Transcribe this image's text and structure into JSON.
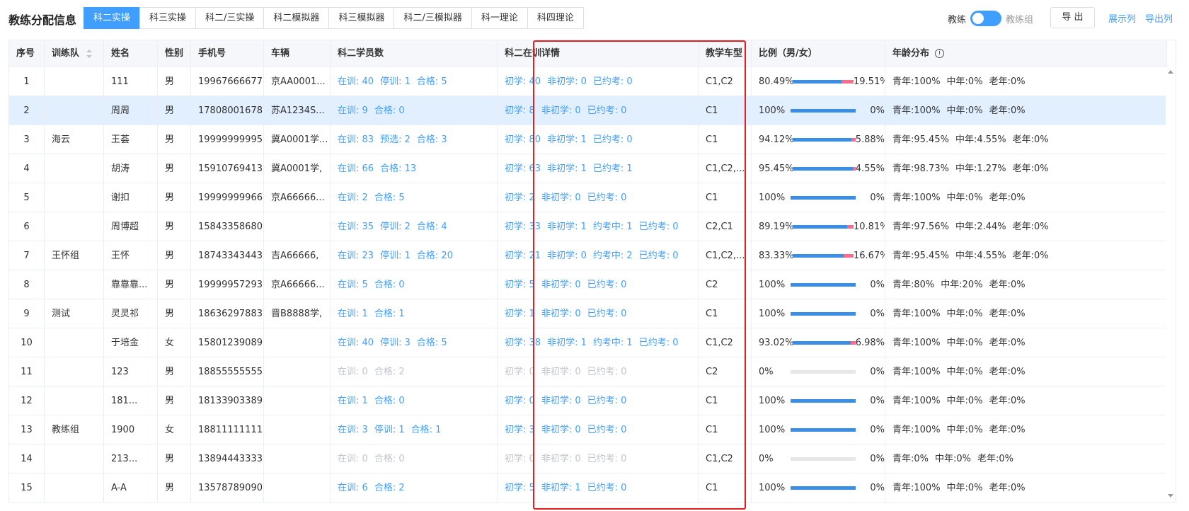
{
  "header": {
    "title": "教练分配信息",
    "tabs": [
      {
        "label": "科二实操",
        "active": true
      },
      {
        "label": "科三实操",
        "active": false
      },
      {
        "label": "科二/三实操",
        "active": false
      },
      {
        "label": "科二模拟器",
        "active": false
      },
      {
        "label": "科三模拟器",
        "active": false
      },
      {
        "label": "科二/三模拟器",
        "active": false
      },
      {
        "label": "科一理论",
        "active": false
      },
      {
        "label": "科四理论",
        "active": false
      }
    ],
    "switch_left": "教练",
    "switch_right": "教练组",
    "export_label": "导 出",
    "show_columns": "展示列",
    "export_columns": "导出列"
  },
  "colors": {
    "accent": "#409eff",
    "highlight": "#e2efff",
    "male_bar": "#3a8ee6",
    "female_bar": "#f56c8d",
    "frame": "#e02020"
  },
  "columns": [
    "序号",
    "训练队",
    "姓名",
    "性别",
    "手机号",
    "车辆",
    "科二学员数",
    "科二在训详情",
    "教学车型",
    "比例（男/女）",
    "年龄分布"
  ],
  "rows": [
    {
      "no": "1",
      "team": "",
      "name": "111",
      "gender": "男",
      "phone": "19967666677",
      "car": "京AA0001...",
      "students": [
        [
          "在训",
          "40"
        ],
        [
          "停训",
          "1"
        ],
        [
          "合格",
          "5"
        ]
      ],
      "detail": [
        [
          "初学",
          "40"
        ],
        [
          "非初学",
          "0"
        ],
        [
          "已约考",
          "0"
        ]
      ],
      "cartype": "C1,C2",
      "male": "80.49%",
      "female": "19.51%",
      "male_ratio": 0.8049,
      "age": [
        "青年:100%",
        "中年:0%",
        "老年:0%"
      ],
      "muted": false
    },
    {
      "no": "2",
      "team": "",
      "name": "周周",
      "gender": "男",
      "phone": "17808001678",
      "car": "苏A1234S...",
      "students": [
        [
          "在训",
          "9"
        ],
        [
          "合格",
          "0"
        ]
      ],
      "detail": [
        [
          "初学",
          "8"
        ],
        [
          "非初学",
          "0"
        ],
        [
          "已约考",
          "0"
        ]
      ],
      "cartype": "C1",
      "male": "100%",
      "female": "0%",
      "male_ratio": 1,
      "age": [
        "青年:100%",
        "中年:0%",
        "老年:0%"
      ],
      "muted": false,
      "highlight": true
    },
    {
      "no": "3",
      "team": "海云",
      "name": "王荟",
      "gender": "男",
      "phone": "19999999995",
      "car": "冀A0001学...",
      "students": [
        [
          "在训",
          "83"
        ],
        [
          "预选",
          "2"
        ],
        [
          "合格",
          "3"
        ]
      ],
      "detail": [
        [
          "初学",
          "80"
        ],
        [
          "非初学",
          "1"
        ],
        [
          "已约考",
          "0"
        ]
      ],
      "cartype": "C1",
      "male": "94.12%",
      "female": "5.88%",
      "male_ratio": 0.9412,
      "age": [
        "青年:95.45%",
        "中年:4.55%",
        "老年:0%"
      ],
      "muted": false
    },
    {
      "no": "4",
      "team": "",
      "name": "胡涛",
      "gender": "男",
      "phone": "15910769413",
      "car": "冀A0001学,",
      "students": [
        [
          "在训",
          "66"
        ],
        [
          "合格",
          "13"
        ]
      ],
      "detail": [
        [
          "初学",
          "63"
        ],
        [
          "非初学",
          "1"
        ],
        [
          "已约考",
          "1"
        ]
      ],
      "cartype": "C1,C2,...",
      "male": "95.45%",
      "female": "4.55%",
      "male_ratio": 0.9545,
      "age": [
        "青年:98.73%",
        "中年:1.27%",
        "老年:0%"
      ],
      "muted": false
    },
    {
      "no": "5",
      "team": "",
      "name": "谢扣",
      "gender": "男",
      "phone": "19999999966",
      "car": "京A66666...",
      "students": [
        [
          "在训",
          "2"
        ],
        [
          "合格",
          "5"
        ]
      ],
      "detail": [
        [
          "初学",
          "2"
        ],
        [
          "非初学",
          "0"
        ],
        [
          "已约考",
          "0"
        ]
      ],
      "cartype": "C1",
      "male": "100%",
      "female": "0%",
      "male_ratio": 1,
      "age": [
        "青年:100%",
        "中年:0%",
        "老年:0%"
      ],
      "muted": false
    },
    {
      "no": "6",
      "team": "",
      "name": "周博超",
      "gender": "男",
      "phone": "15843358680",
      "car": "",
      "students": [
        [
          "在训",
          "35"
        ],
        [
          "停训",
          "2"
        ],
        [
          "合格",
          "4"
        ]
      ],
      "detail": [
        [
          "初学",
          "33"
        ],
        [
          "非初学",
          "1"
        ],
        [
          "约考中",
          "1"
        ],
        [
          "已约考",
          "0"
        ]
      ],
      "cartype": "C2,C1",
      "male": "89.19%",
      "female": "10.81%",
      "male_ratio": 0.8919,
      "age": [
        "青年:97.56%",
        "中年:2.44%",
        "老年:0%"
      ],
      "muted": false
    },
    {
      "no": "7",
      "team": "王怀组",
      "name": "王怀",
      "gender": "男",
      "phone": "18743343443",
      "car": "吉A66666,",
      "students": [
        [
          "在训",
          "23"
        ],
        [
          "停训",
          "1"
        ],
        [
          "合格",
          "20"
        ]
      ],
      "detail": [
        [
          "初学",
          "21"
        ],
        [
          "非初学",
          "0"
        ],
        [
          "约考中",
          "2"
        ],
        [
          "已约考",
          "0"
        ]
      ],
      "cartype": "C1,C2,...",
      "male": "83.33%",
      "female": "16.67%",
      "male_ratio": 0.8333,
      "age": [
        "青年:95.45%",
        "中年:4.55%",
        "老年:0%"
      ],
      "muted": false
    },
    {
      "no": "8",
      "team": "",
      "name": "靠靠靠...",
      "gender": "男",
      "phone": "19999957293",
      "car": "京A66666...",
      "students": [
        [
          "在训",
          "5"
        ],
        [
          "合格",
          "0"
        ]
      ],
      "detail": [
        [
          "初学",
          "5"
        ],
        [
          "非初学",
          "0"
        ],
        [
          "已约考",
          "0"
        ]
      ],
      "cartype": "C2",
      "male": "100%",
      "female": "0%",
      "male_ratio": 1,
      "age": [
        "青年:80%",
        "中年:20%",
        "老年:0%"
      ],
      "muted": false
    },
    {
      "no": "9",
      "team": "测试",
      "name": "灵灵祁",
      "gender": "男",
      "phone": "18636297883",
      "car": "晋B8888学,",
      "students": [
        [
          "在训",
          "1"
        ],
        [
          "合格",
          "1"
        ]
      ],
      "detail": [
        [
          "初学",
          "1"
        ],
        [
          "非初学",
          "0"
        ],
        [
          "已约考",
          "0"
        ]
      ],
      "cartype": "C1",
      "male": "100%",
      "female": "0%",
      "male_ratio": 1,
      "age": [
        "青年:100%",
        "中年:0%",
        "老年:0%"
      ],
      "muted": false
    },
    {
      "no": "10",
      "team": "",
      "name": "于培金",
      "gender": "女",
      "phone": "15801239089",
      "car": "",
      "students": [
        [
          "在训",
          "40"
        ],
        [
          "停训",
          "3"
        ],
        [
          "合格",
          "5"
        ]
      ],
      "detail": [
        [
          "初学",
          "38"
        ],
        [
          "非初学",
          "1"
        ],
        [
          "约考中",
          "1"
        ],
        [
          "已约考",
          "0"
        ]
      ],
      "cartype": "C1,C2",
      "male": "93.02%",
      "female": "6.98%",
      "male_ratio": 0.9302,
      "age": [
        "青年:100%",
        "中年:0%",
        "老年:0%"
      ],
      "muted": false
    },
    {
      "no": "11",
      "team": "",
      "name": "123",
      "gender": "男",
      "phone": "18855555555",
      "car": "",
      "students": [
        [
          "在训",
          "0"
        ],
        [
          "合格",
          "2"
        ]
      ],
      "detail": [
        [
          "初学",
          "0"
        ],
        [
          "非初学",
          "0"
        ],
        [
          "已约考",
          "0"
        ]
      ],
      "cartype": "C2",
      "male": "0%",
      "female": "0%",
      "male_ratio": 0,
      "age": [
        "青年:100%",
        "中年:0%",
        "老年:0%"
      ],
      "muted": true
    },
    {
      "no": "12",
      "team": "",
      "name": "181...",
      "gender": "男",
      "phone": "18133903389",
      "car": "",
      "students": [
        [
          "在训",
          "1"
        ],
        [
          "合格",
          "0"
        ]
      ],
      "detail": [
        [
          "初学",
          "0"
        ],
        [
          "非初学",
          "0"
        ],
        [
          "已约考",
          "0"
        ]
      ],
      "cartype": "C1",
      "male": "100%",
      "female": "0%",
      "male_ratio": 1,
      "age": [
        "青年:100%",
        "中年:0%",
        "老年:0%"
      ],
      "muted": false
    },
    {
      "no": "13",
      "team": "教练组",
      "name": "1900",
      "gender": "女",
      "phone": "18811111111",
      "car": "",
      "students": [
        [
          "在训",
          "3"
        ],
        [
          "停训",
          "1"
        ],
        [
          "合格",
          "1"
        ]
      ],
      "detail": [
        [
          "初学",
          "3"
        ],
        [
          "非初学",
          "0"
        ],
        [
          "已约考",
          "0"
        ]
      ],
      "cartype": "C1",
      "male": "100%",
      "female": "0%",
      "male_ratio": 1,
      "age": [
        "青年:100%",
        "中年:0%",
        "老年:0%"
      ],
      "muted": false
    },
    {
      "no": "14",
      "team": "",
      "name": "213...",
      "gender": "男",
      "phone": "13894443333",
      "car": "",
      "students": [
        [
          "在训",
          "0"
        ],
        [
          "合格",
          "0"
        ]
      ],
      "detail": [
        [
          "初学",
          "0"
        ],
        [
          "非初学",
          "0"
        ],
        [
          "已约考",
          "0"
        ]
      ],
      "cartype": "C1,C2",
      "male": "0%",
      "female": "0%",
      "male_ratio": 0,
      "age": [
        "青年:0%",
        "中年:0%",
        "老年:0%"
      ],
      "muted": true
    },
    {
      "no": "15",
      "team": "",
      "name": "A-A",
      "gender": "男",
      "phone": "13578789090",
      "car": "",
      "students": [
        [
          "在训",
          "6"
        ],
        [
          "合格",
          "2"
        ]
      ],
      "detail": [
        [
          "初学",
          "5"
        ],
        [
          "非初学",
          "1"
        ],
        [
          "已约考",
          "0"
        ]
      ],
      "cartype": "C1",
      "male": "100%",
      "female": "0%",
      "male_ratio": 1,
      "age": [
        "青年:100%",
        "中年:0%",
        "老年:0%"
      ],
      "muted": false
    }
  ]
}
